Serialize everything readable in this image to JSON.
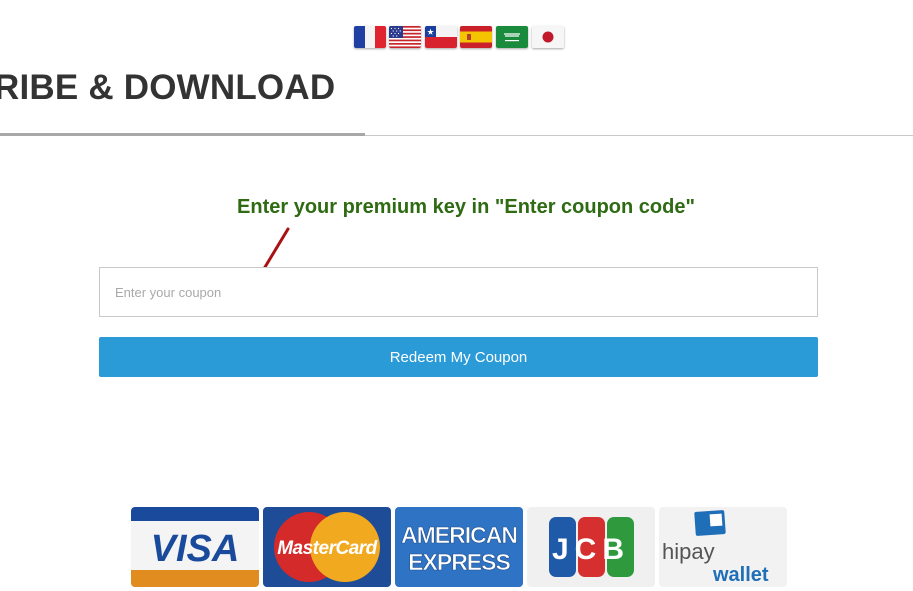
{
  "header": {
    "title": "RIBE & DOWNLOAD",
    "languages": [
      {
        "name": "french-flag",
        "code": "fr"
      },
      {
        "name": "us-flag",
        "code": "en"
      },
      {
        "name": "chile-flag",
        "code": "es-cl"
      },
      {
        "name": "spain-flag",
        "code": "es"
      },
      {
        "name": "saudi-flag",
        "code": "ar"
      },
      {
        "name": "japan-flag",
        "code": "ja"
      }
    ]
  },
  "main": {
    "instruction": "Enter your premium key in \"Enter coupon code\"",
    "coupon_placeholder": "Enter your coupon",
    "coupon_value": "",
    "redeem_label": "Redeem My Coupon"
  },
  "payment_cards": {
    "visa": "VISA",
    "mastercard": "MasterCard",
    "amex_line1": "AMERICAN",
    "amex_line2": "EXPRESS",
    "jcb": "JCB",
    "hipay_line1": "hipay",
    "hipay_line2": "wallet"
  },
  "colors": {
    "accent_blue": "#2b9bd8",
    "instruction_green": "#2e6b12",
    "arrow_red": "#a10e0e"
  }
}
